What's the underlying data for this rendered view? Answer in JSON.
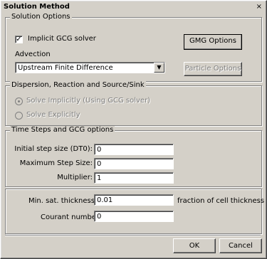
{
  "window": {
    "title": "Solution Method",
    "close_glyph": "×"
  },
  "solution_options": {
    "legend": "Solution Options",
    "implicit_gcg": {
      "label": "Implicit GCG solver",
      "checked": true
    },
    "gmg_button": "GMG Options",
    "advection_label": "Advection",
    "advection_value": "Upstream Finite Difference",
    "particle_button": "Particle Options"
  },
  "dispersion": {
    "legend": "Dispersion, Reaction and Source/Sink",
    "implicit_label": "Solve Implicitly (Using GCG solver)",
    "explicit_label": "Solve Explicitly"
  },
  "time_steps": {
    "legend": "Time Steps and GCG options",
    "dt0_label": "Initial step size (DT0):",
    "dt0_value": "0",
    "max_step_label": "Maximum Step Size:",
    "max_step_value": "0",
    "multiplier_label": "Multiplier:",
    "multiplier_value": "1"
  },
  "misc": {
    "min_sat_label": "Min. sat. thickness",
    "min_sat_value": "0.01",
    "min_sat_unit": "fraction of cell thickness",
    "courant_label": "Courant number",
    "courant_value": "0"
  },
  "buttons": {
    "ok": "OK",
    "cancel": "Cancel"
  }
}
